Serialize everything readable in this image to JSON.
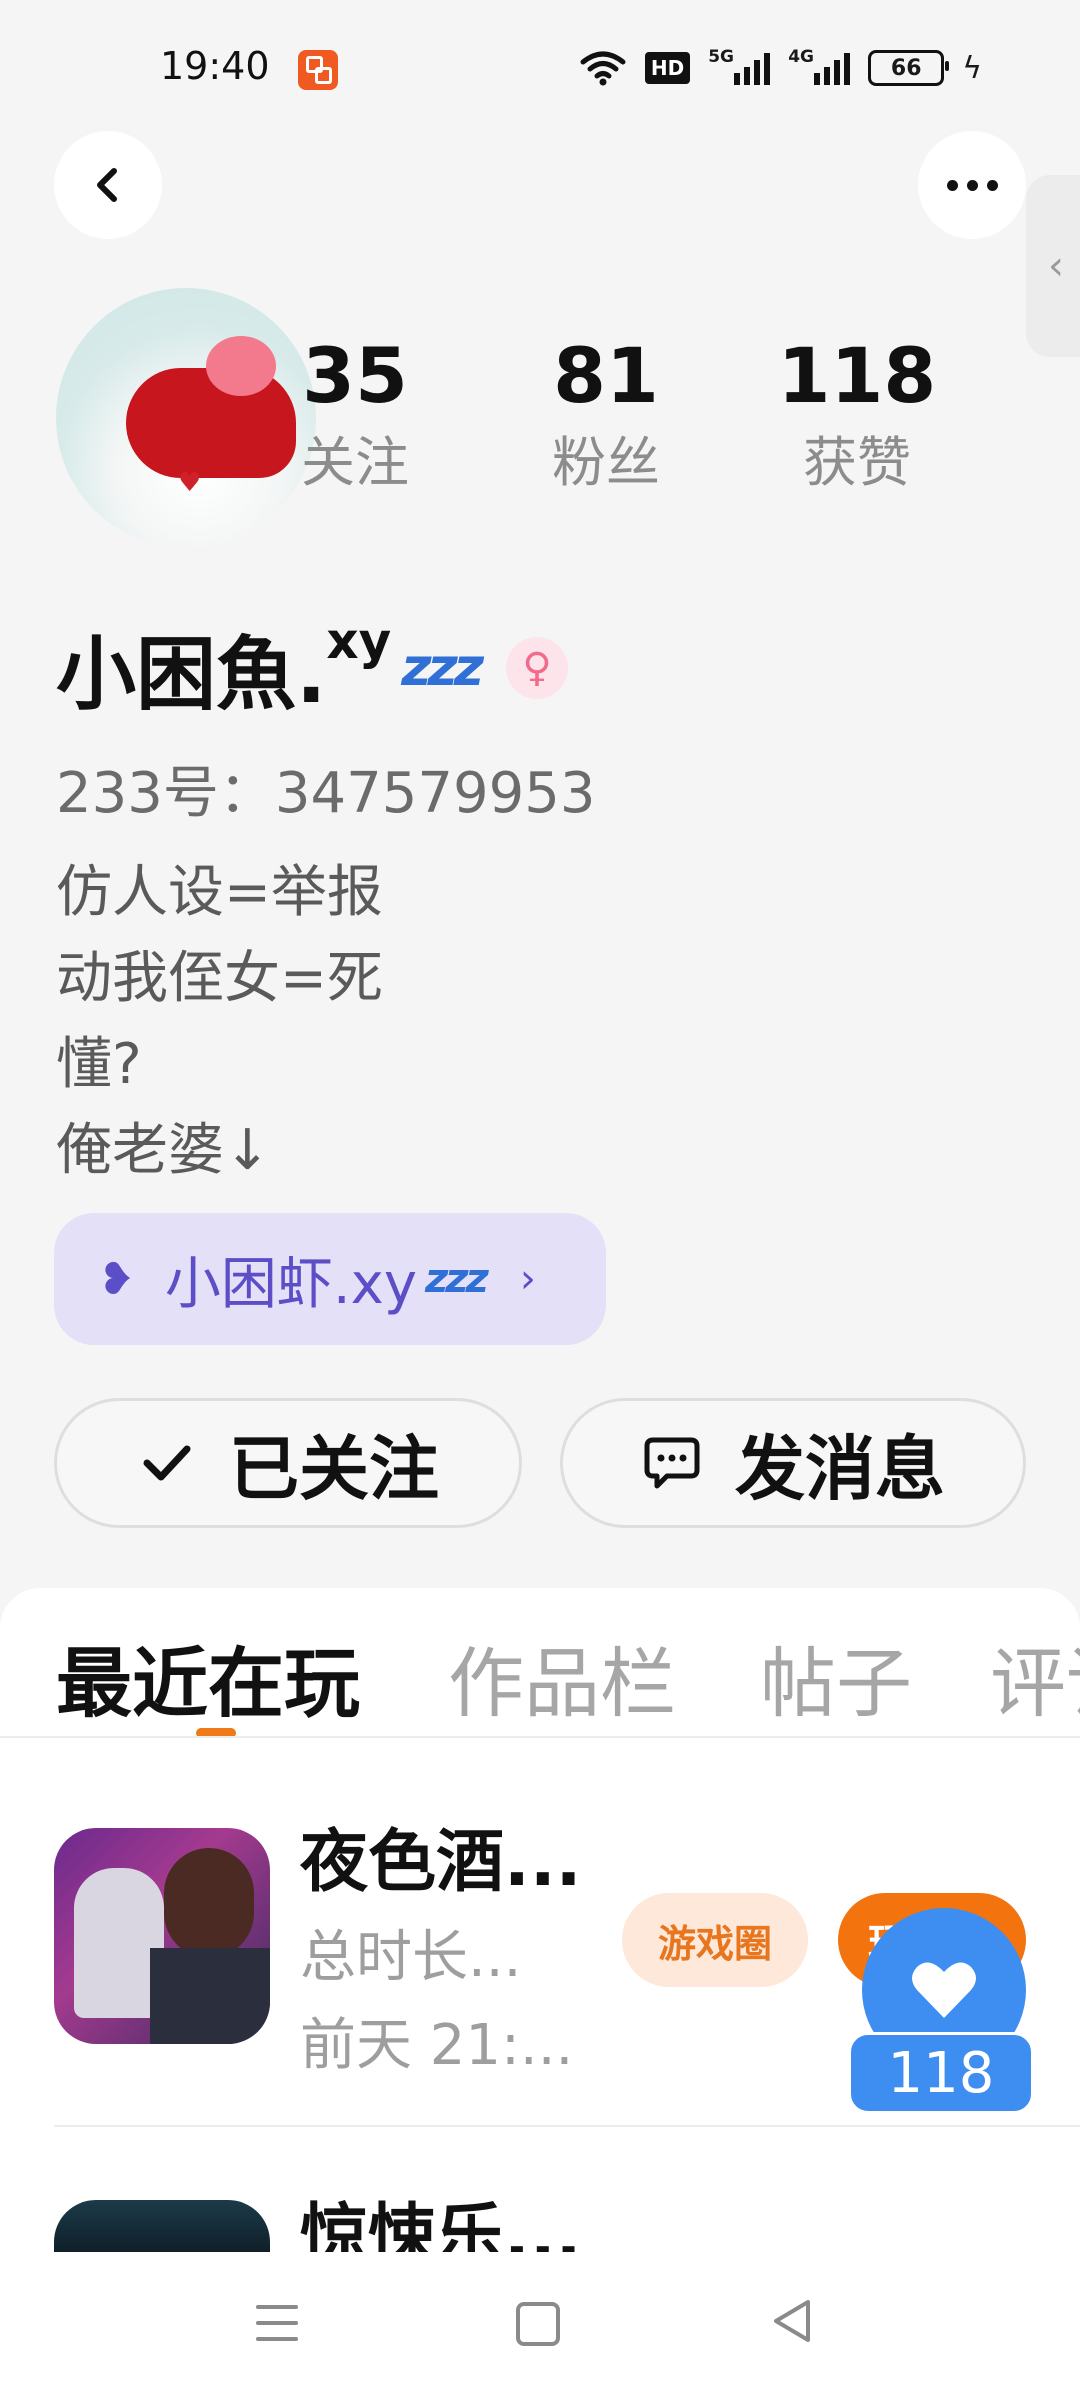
{
  "status_bar": {
    "time": "19:40",
    "battery": "66",
    "hd_label": "HD",
    "net1": "5G",
    "net2": "4G",
    "icons": [
      "app-notification-icon",
      "wifi-icon",
      "hd-icon",
      "signal-5g-icon",
      "signal-4g-icon",
      "battery-icon",
      "charging-icon"
    ]
  },
  "profile": {
    "stats": [
      {
        "value": "35",
        "label": "关注"
      },
      {
        "value": "81",
        "label": "粉丝"
      },
      {
        "value": "118",
        "label": "获赞"
      }
    ],
    "name": "小困魚.",
    "name_suffix": "xy",
    "zzz": "zzz",
    "uid": "233号：347579953",
    "bio": [
      "仿人设=举报",
      "动我侄女=死",
      "懂?",
      "俺老婆↓"
    ],
    "partner": {
      "name": "小困虾.xy",
      "zzz": "zzz"
    }
  },
  "actions": {
    "follow_label": "已关注",
    "message_label": "发消息"
  },
  "tabs": [
    "最近在玩",
    "作品栏",
    "帖子",
    "评论"
  ],
  "games": [
    {
      "title": "夜色酒...",
      "sub1": "总时长...",
      "sub2": "前天 21:...",
      "community": "游戏圈",
      "play": "玩"
    },
    {
      "title": "惊悚乐..."
    }
  ],
  "like_float": {
    "count": "118"
  },
  "colors": {
    "accent_orange": "#f3730f",
    "like_blue": "#3d8ef0",
    "partner_purple": "#5b4ec7"
  }
}
